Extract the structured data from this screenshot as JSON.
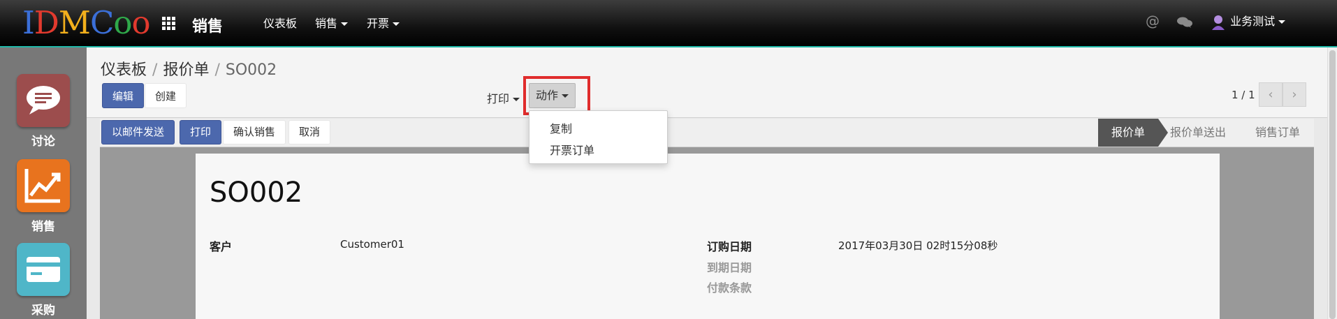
{
  "header": {
    "logo_letters": [
      "I",
      "D",
      "M",
      "C",
      "o",
      "o"
    ],
    "logo_colors": [
      "#3b6fd8",
      "#e23a2e",
      "#f3b01c",
      "#3b6fd8",
      "#2fa84a",
      "#e23a2e"
    ],
    "app_name": "销售",
    "nav": [
      "仪表板",
      "销售",
      "开票"
    ],
    "at_symbol": "@",
    "user_name": "业务测试"
  },
  "sidebar": {
    "items": [
      {
        "label": "讨论",
        "color": "#9c4d4d"
      },
      {
        "label": "销售",
        "color": "#e8731e"
      },
      {
        "label": "采购",
        "color": "#4fb6c8"
      }
    ]
  },
  "breadcrumb": {
    "root": "仪表板",
    "middle": "报价单",
    "current": "SO002"
  },
  "toolbar": {
    "edit": "编辑",
    "create": "创建",
    "print": "打印",
    "action": "动作",
    "pager": "1 / 1"
  },
  "action_menu": {
    "items": [
      "复制",
      "开票订单"
    ]
  },
  "form_buttons": {
    "email": "以邮件发送",
    "print": "打印",
    "confirm": "确认销售",
    "cancel": "取消"
  },
  "stages": {
    "active": "报价单",
    "sent": "报价单送出",
    "sale": "销售订单"
  },
  "document": {
    "name": "SO002",
    "customer_label": "客户",
    "customer_value": "Customer01",
    "order_date_label": "订购日期",
    "order_date_value": "2017年03月30日 02时15分08秒",
    "expiry_label": "到期日期",
    "payment_terms_label": "付款条款"
  },
  "colors": {
    "primary": "#4c68ad",
    "navbar_accent": "#1fb8a8",
    "highlight": "#e02c2c"
  }
}
